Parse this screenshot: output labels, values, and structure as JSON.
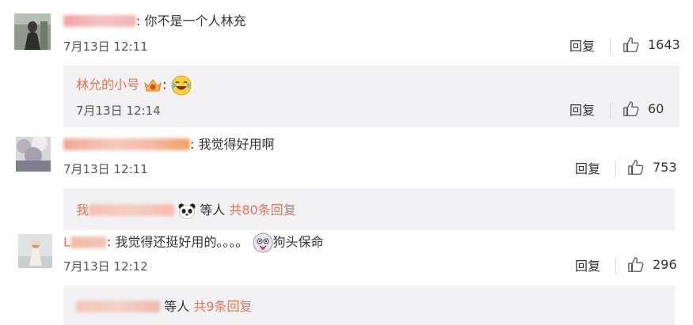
{
  "comments": [
    {
      "text": "你不是一个人林充",
      "time": "7月13日 12:11",
      "reply_label": "回复",
      "likes": "1643",
      "sub_reply": {
        "name": "林允的小号",
        "colon": ":",
        "time": "7月13日 12:14",
        "reply_label": "回复",
        "likes": "60"
      }
    },
    {
      "text": "我觉得好用啊",
      "time": "7月13日 12:11",
      "reply_label": "回复",
      "likes": "753",
      "more": {
        "name_prefix": "我",
        "suffix": "等人",
        "count_label": "共80条回复"
      }
    },
    {
      "name_prefix": "L",
      "text": "我觉得还挺好用的。。。。",
      "text_after_emoji": "狗头保命",
      "time": "7月13日 12:12",
      "reply_label": "回复",
      "likes": "296",
      "more": {
        "suffix": "等人",
        "count_label": "共9条回复"
      }
    }
  ],
  "colors": {
    "accent": "#eb7350",
    "text": "#333333",
    "time": "#555555",
    "sub_bg": "#f2f2f5"
  },
  "icons": [
    "thumbs-up-icon",
    "laughing-emoji",
    "crown-badge-icon",
    "panda-emoji",
    "doge-emoji"
  ]
}
